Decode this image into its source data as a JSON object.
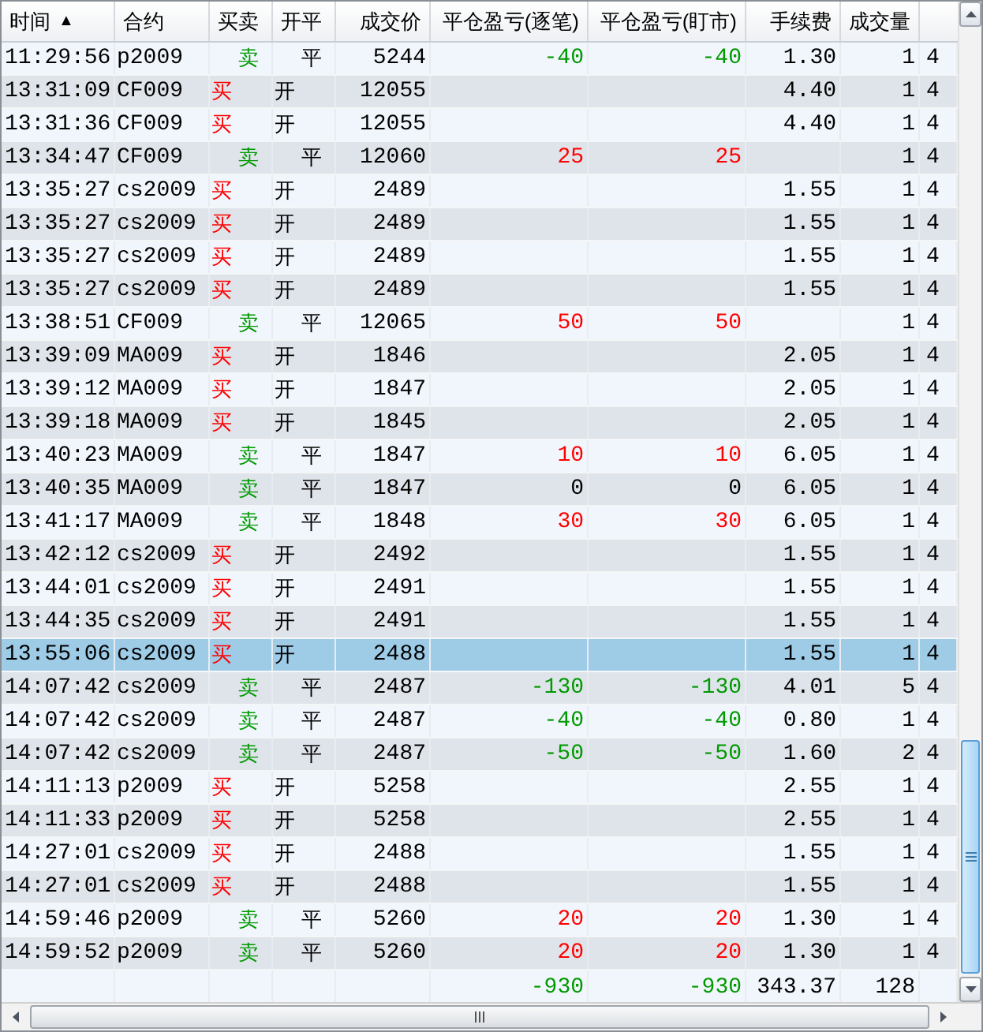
{
  "columns": [
    {
      "label": "时间",
      "sort_indicator": "▲"
    },
    {
      "label": "合约"
    },
    {
      "label": "买卖"
    },
    {
      "label": "开平"
    },
    {
      "label": "成交价"
    },
    {
      "label": "平仓盈亏(逐笔)"
    },
    {
      "label": "平仓盈亏(盯市)"
    },
    {
      "label": "手续费"
    },
    {
      "label": "成交量"
    }
  ],
  "rows": [
    {
      "time": "11:29:56",
      "contract": "p2009",
      "kind": "sell",
      "side": "卖",
      "offset": "平",
      "price": "5244",
      "pnl_trade": "-40",
      "pnl_mark": "-40",
      "color": "#009900",
      "fee": "1.30",
      "qty": "1",
      "column_10": "4",
      "selected": false
    },
    {
      "time": "13:31:09",
      "contract": "CF009",
      "kind": "buy",
      "side": "买",
      "offset": "开",
      "price": "12055",
      "fee": "4.40",
      "qty": "1",
      "column_10": "4",
      "selected": false
    },
    {
      "time": "13:31:36",
      "contract": "CF009",
      "kind": "buy",
      "side": "买",
      "offset": "开",
      "price": "12055",
      "fee": "4.40",
      "qty": "1",
      "column_10": "4",
      "selected": false
    },
    {
      "time": "13:34:47",
      "contract": "CF009",
      "kind": "sell",
      "side": "卖",
      "offset": "平",
      "price": "12060",
      "pnl_trade": "25",
      "pnl_mark": "25",
      "color": "#ff0000",
      "qty": "1",
      "column_10": "4",
      "selected": false
    },
    {
      "time": "13:35:27",
      "contract": "cs2009",
      "kind": "buy",
      "side": "买",
      "offset": "开",
      "price": "2489",
      "fee": "1.55",
      "qty": "1",
      "column_10": "4",
      "selected": false
    },
    {
      "time": "13:35:27",
      "contract": "cs2009",
      "kind": "buy",
      "side": "买",
      "offset": "开",
      "price": "2489",
      "fee": "1.55",
      "qty": "1",
      "column_10": "4",
      "selected": false
    },
    {
      "time": "13:35:27",
      "contract": "cs2009",
      "kind": "buy",
      "side": "买",
      "offset": "开",
      "price": "2489",
      "fee": "1.55",
      "qty": "1",
      "column_10": "4",
      "selected": false
    },
    {
      "time": "13:35:27",
      "contract": "cs2009",
      "kind": "buy",
      "side": "买",
      "offset": "开",
      "price": "2489",
      "fee": "1.55",
      "qty": "1",
      "column_10": "4",
      "selected": false
    },
    {
      "time": "13:38:51",
      "contract": "CF009",
      "kind": "sell",
      "side": "卖",
      "offset": "平",
      "price": "12065",
      "pnl_trade": "50",
      "pnl_mark": "50",
      "color": "#ff0000",
      "qty": "1",
      "column_10": "4",
      "selected": false
    },
    {
      "time": "13:39:09",
      "contract": "MA009",
      "kind": "buy",
      "side": "买",
      "offset": "开",
      "price": "1846",
      "fee": "2.05",
      "qty": "1",
      "column_10": "4",
      "selected": false
    },
    {
      "time": "13:39:12",
      "contract": "MA009",
      "kind": "buy",
      "side": "买",
      "offset": "开",
      "price": "1847",
      "fee": "2.05",
      "qty": "1",
      "column_10": "4",
      "selected": false
    },
    {
      "time": "13:39:18",
      "contract": "MA009",
      "kind": "buy",
      "side": "买",
      "offset": "开",
      "price": "1845",
      "fee": "2.05",
      "qty": "1",
      "column_10": "4",
      "selected": false
    },
    {
      "time": "13:40:23",
      "contract": "MA009",
      "kind": "sell",
      "side": "卖",
      "offset": "平",
      "price": "1847",
      "pnl_trade": "10",
      "pnl_mark": "10",
      "color": "#ff0000",
      "fee": "6.05",
      "qty": "1",
      "column_10": "4",
      "selected": false
    },
    {
      "time": "13:40:35",
      "contract": "MA009",
      "kind": "sell",
      "side": "卖",
      "offset": "平",
      "price": "1847",
      "pnl_trade": "0",
      "pnl_mark": "0",
      "color": "#000000",
      "fee": "6.05",
      "qty": "1",
      "column_10": "4",
      "selected": false
    },
    {
      "time": "13:41:17",
      "contract": "MA009",
      "kind": "sell",
      "side": "卖",
      "offset": "平",
      "price": "1848",
      "pnl_trade": "30",
      "pnl_mark": "30",
      "color": "#ff0000",
      "fee": "6.05",
      "qty": "1",
      "column_10": "4",
      "selected": false
    },
    {
      "time": "13:42:12",
      "contract": "cs2009",
      "kind": "buy",
      "side": "买",
      "offset": "开",
      "price": "2492",
      "fee": "1.55",
      "qty": "1",
      "column_10": "4",
      "selected": false
    },
    {
      "time": "13:44:01",
      "contract": "cs2009",
      "kind": "buy",
      "side": "买",
      "offset": "开",
      "price": "2491",
      "fee": "1.55",
      "qty": "1",
      "column_10": "4",
      "selected": false
    },
    {
      "time": "13:44:35",
      "contract": "cs2009",
      "kind": "buy",
      "side": "买",
      "offset": "开",
      "price": "2491",
      "fee": "1.55",
      "qty": "1",
      "column_10": "4",
      "selected": false
    },
    {
      "time": "13:55:06",
      "contract": "cs2009",
      "kind": "buy",
      "side": "买",
      "offset": "开",
      "price": "2488",
      "fee": "1.55",
      "qty": "1",
      "column_10": "4",
      "selected": true
    },
    {
      "time": "14:07:42",
      "contract": "cs2009",
      "kind": "sell",
      "side": "卖",
      "offset": "平",
      "price": "2487",
      "pnl_trade": "-130",
      "pnl_mark": "-130",
      "color": "#009900",
      "fee": "4.01",
      "qty": "5",
      "column_10": "4",
      "selected": false
    },
    {
      "time": "14:07:42",
      "contract": "cs2009",
      "kind": "sell",
      "side": "卖",
      "offset": "平",
      "price": "2487",
      "pnl_trade": "-40",
      "pnl_mark": "-40",
      "color": "#009900",
      "fee": "0.80",
      "qty": "1",
      "column_10": "4",
      "selected": false
    },
    {
      "time": "14:07:42",
      "contract": "cs2009",
      "kind": "sell",
      "side": "卖",
      "offset": "平",
      "price": "2487",
      "pnl_trade": "-50",
      "pnl_mark": "-50",
      "color": "#009900",
      "fee": "1.60",
      "qty": "2",
      "column_10": "4",
      "selected": false
    },
    {
      "time": "14:11:13",
      "contract": "p2009",
      "kind": "buy",
      "side": "买",
      "offset": "开",
      "price": "5258",
      "fee": "2.55",
      "qty": "1",
      "column_10": "4",
      "selected": false
    },
    {
      "time": "14:11:33",
      "contract": "p2009",
      "kind": "buy",
      "side": "买",
      "offset": "开",
      "price": "5258",
      "fee": "2.55",
      "qty": "1",
      "column_10": "4",
      "selected": false
    },
    {
      "time": "14:27:01",
      "contract": "cs2009",
      "kind": "buy",
      "side": "买",
      "offset": "开",
      "price": "2488",
      "fee": "1.55",
      "qty": "1",
      "column_10": "4",
      "selected": false
    },
    {
      "time": "14:27:01",
      "contract": "cs2009",
      "kind": "buy",
      "side": "买",
      "offset": "开",
      "price": "2488",
      "fee": "1.55",
      "qty": "1",
      "column_10": "4",
      "selected": false
    },
    {
      "time": "14:59:46",
      "contract": "p2009",
      "kind": "sell",
      "side": "卖",
      "offset": "平",
      "price": "5260",
      "pnl_trade": "20",
      "pnl_mark": "20",
      "color": "#ff0000",
      "fee": "1.30",
      "qty": "1",
      "column_10": "4",
      "selected": false
    },
    {
      "time": "14:59:52",
      "contract": "p2009",
      "kind": "sell",
      "side": "卖",
      "offset": "平",
      "price": "5260",
      "pnl_trade": "20",
      "pnl_mark": "20",
      "color": "#ff0000",
      "fee": "1.30",
      "qty": "1",
      "column_10": "4",
      "selected": false
    }
  ],
  "totals": {
    "pnl_trade": "-930",
    "pnl_mark": "-930",
    "color": "#009900",
    "fee": "343.37",
    "qty": "128"
  }
}
